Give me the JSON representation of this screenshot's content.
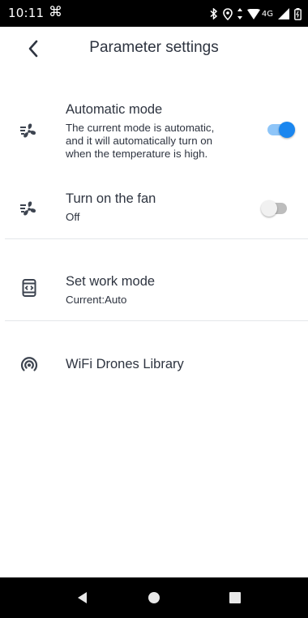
{
  "status_bar": {
    "time": "10:11",
    "app_icon": "⌘",
    "network": "4G",
    "icons": [
      "bluetooth-icon",
      "location-icon",
      "data-arrows-icon",
      "wifi-icon",
      "cell-signal-icon",
      "battery-icon"
    ]
  },
  "header": {
    "title": "Parameter settings",
    "back_icon": "chevron-left-icon"
  },
  "settings": {
    "automatic_mode": {
      "title": "Automatic mode",
      "desc_line1": "The current mode is automatic,",
      "desc_line2": "and it will automatically turn on",
      "desc_line3": "when the temperature is high.",
      "enabled": true,
      "icon": "fan-icon"
    },
    "turn_on_fan": {
      "title": "Turn on the fan",
      "value": "Off",
      "enabled": false,
      "icon": "fan-icon"
    },
    "work_mode": {
      "title": "Set work mode",
      "value": "Current:Auto",
      "icon": "device-mode-icon"
    },
    "library": {
      "title": "WiFi Drones Library",
      "icon": "broadcast-icon"
    }
  },
  "nav_bar": {
    "buttons": [
      "back-triangle-icon",
      "home-circle-icon",
      "recents-square-icon"
    ]
  },
  "colors": {
    "accent": "#1a86ef",
    "accent_track": "#8ec5f8",
    "text": "#2e3440",
    "bars": "#000000"
  }
}
